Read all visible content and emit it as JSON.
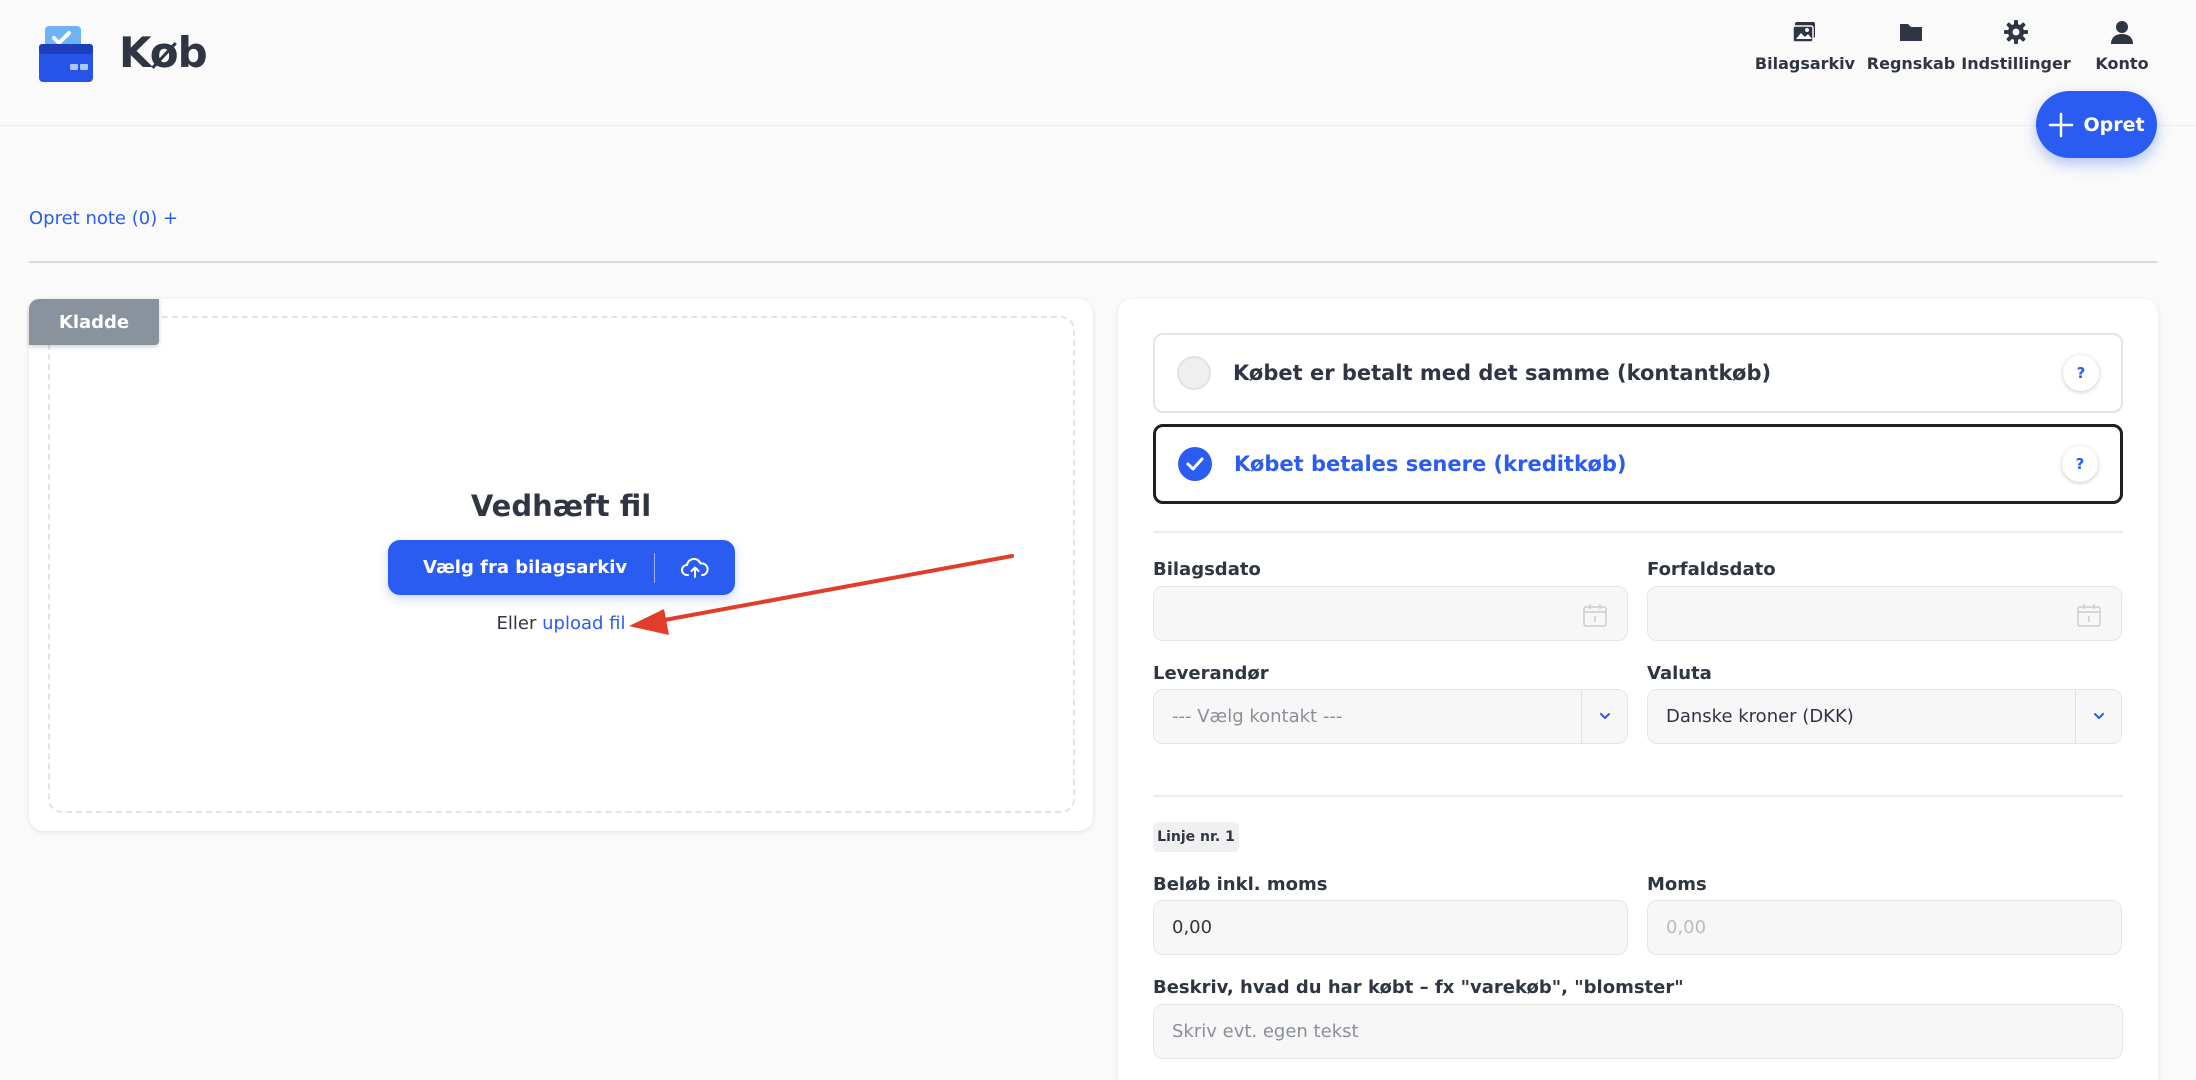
{
  "header": {
    "title": "Køb",
    "nav": [
      {
        "label": "Bilagsarkiv",
        "icon": "photo-archive-icon"
      },
      {
        "label": "Regnskab",
        "icon": "folder-icon"
      },
      {
        "label": "Indstillinger",
        "icon": "gear-icon"
      },
      {
        "label": "Konto",
        "icon": "user-icon"
      }
    ],
    "create_label": "Opret"
  },
  "note_link": "Opret note (0) +",
  "left": {
    "badge": "Kladde",
    "attach_title": "Vedhæft fil",
    "choose_button": "Vælg fra bilagsarkiv",
    "upload_prefix": "Eller",
    "upload_link": "upload fil"
  },
  "payment": {
    "options": [
      {
        "label": "Købet er betalt med det samme (kontantkøb)",
        "selected": false,
        "help": "?"
      },
      {
        "label": "Købet betales senere (kreditkøb)",
        "selected": true,
        "help": "?"
      }
    ]
  },
  "form": {
    "bilagsdato": {
      "label": "Bilagsdato",
      "value": ""
    },
    "forfaldsdato": {
      "label": "Forfaldsdato",
      "value": ""
    },
    "leverandor": {
      "label": "Leverandør",
      "placeholder": "--- Vælg kontakt ---"
    },
    "valuta": {
      "label": "Valuta",
      "value": "Danske kroner (DKK)"
    },
    "line_badge": "Linje nr. 1",
    "belob": {
      "label": "Beløb inkl. moms",
      "value": "0,00"
    },
    "moms": {
      "label": "Moms",
      "value": "0,00"
    },
    "beskriv": {
      "label": "Beskriv, hvad du har købt – fx \"varekøb\", \"blomster\"",
      "placeholder": "Skriv evt. egen tekst"
    }
  },
  "colors": {
    "accent": "#2a5cf2",
    "annotation_arrow": "#e23d2a",
    "draft_badge": "#8a929e"
  }
}
